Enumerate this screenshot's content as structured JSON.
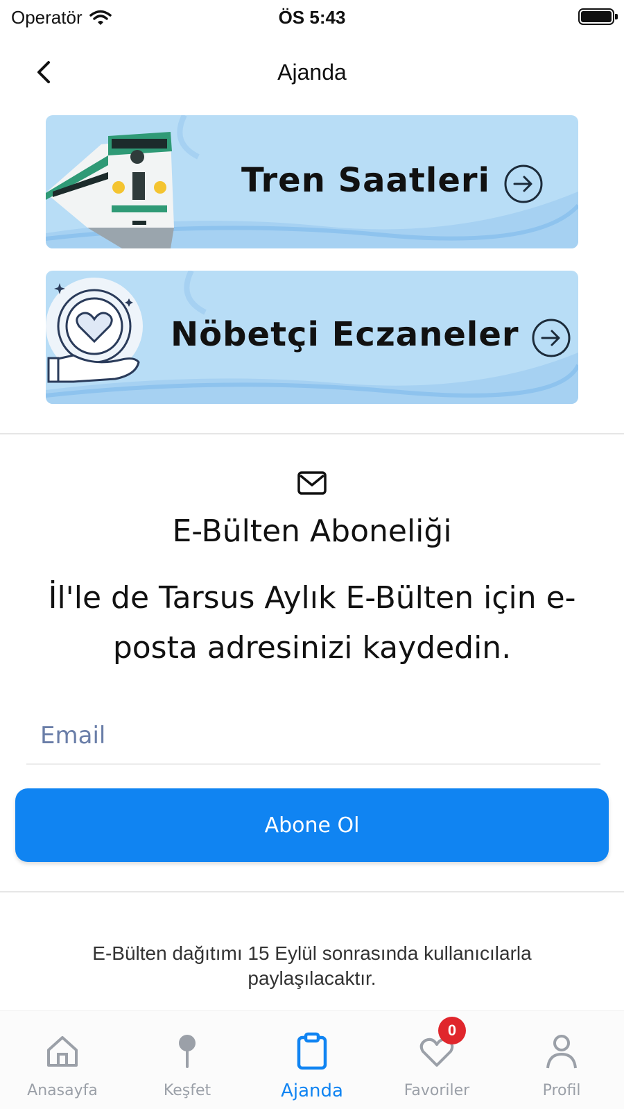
{
  "status_bar": {
    "carrier": "Operatör",
    "time": "ÖS 5:43"
  },
  "nav": {
    "title": "Ajanda",
    "back_icon": "chevron-left-icon"
  },
  "banners": [
    {
      "label": "Tren Saatleri",
      "icon": "train-illustration",
      "arrow_icon": "arrow-right-circle-icon"
    },
    {
      "label": "Nöbetçi Eczaneler",
      "icon": "heart-hand-illustration",
      "arrow_icon": "arrow-right-circle-icon"
    }
  ],
  "newsletter": {
    "icon": "mail-icon",
    "title": "E-Bülten Aboneliği",
    "description": "İl'le de Tarsus Aylık E-Bülten için e-posta adresinizi kaydedin.",
    "email_placeholder": "Email",
    "email_value": "",
    "subscribe_label": "Abone Ol",
    "notice": "E-Bülten dağıtımı 15 Eylül sonrasında kullanıcılarla paylaşılacaktır."
  },
  "tab_bar": {
    "tabs": [
      {
        "label": "Anasayfa",
        "icon": "home-icon",
        "active": false
      },
      {
        "label": "Keşfet",
        "icon": "pin-icon",
        "active": false
      },
      {
        "label": "Ajanda",
        "icon": "clipboard-icon",
        "active": true
      },
      {
        "label": "Favoriler",
        "icon": "heart-icon",
        "active": false,
        "badge": "0"
      },
      {
        "label": "Profil",
        "icon": "user-icon",
        "active": false
      }
    ]
  },
  "colors": {
    "accent": "#1084f2",
    "banner_bg": "#b8ddf6",
    "badge": "#e0262c",
    "inactive_tab": "#9ba0a8"
  }
}
